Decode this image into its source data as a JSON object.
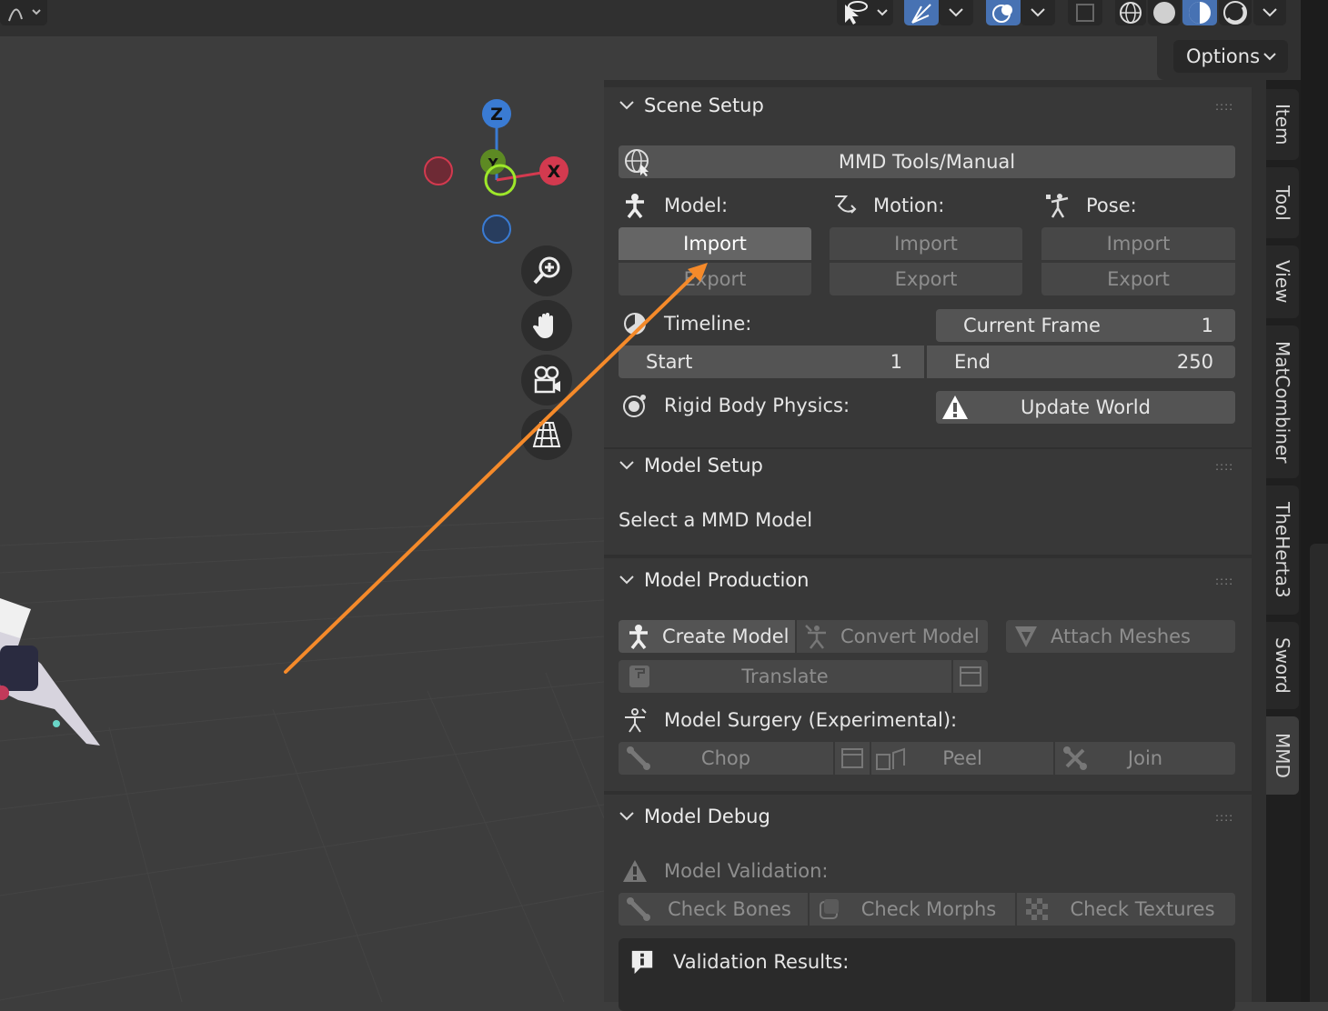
{
  "header": {
    "options_label": "Options"
  },
  "gizmo": {
    "z_label": "Z",
    "x_label": "X",
    "y_label": "Y"
  },
  "scene_setup": {
    "title": "Scene Setup",
    "manual_button": "MMD Tools/Manual",
    "model_label": "Model:",
    "motion_label": "Motion:",
    "pose_label": "Pose:",
    "model_import": "Import",
    "model_export": "Export",
    "motion_import": "Import",
    "motion_export": "Export",
    "pose_import": "Import",
    "pose_export": "Export",
    "timeline_label": "Timeline:",
    "current_frame_label": "Current Frame",
    "current_frame_value": "1",
    "start_label": "Start",
    "start_value": "1",
    "end_label": "End",
    "end_value": "250",
    "rigid_body_label": "Rigid Body Physics:",
    "update_world_button": "Update World"
  },
  "model_setup": {
    "title": "Model Setup",
    "message": "Select a MMD Model"
  },
  "model_production": {
    "title": "Model Production",
    "create_model": "Create Model",
    "convert_model": "Convert Model",
    "attach_meshes": "Attach Meshes",
    "translate": "Translate",
    "surgery_label": "Model Surgery (Experimental):",
    "chop": "Chop",
    "peel": "Peel",
    "join": "Join"
  },
  "model_debug": {
    "title": "Model Debug",
    "validation_label": "Model Validation:",
    "check_bones": "Check Bones",
    "check_morphs": "Check Morphs",
    "check_textures": "Check Textures",
    "validation_results": "Validation Results:"
  },
  "tabs": [
    "Item",
    "Tool",
    "View",
    "MatCombiner",
    "TheHerta3",
    "Sword",
    "MMD"
  ],
  "colors": {
    "accent_blue": "#4772b3",
    "annotation_arrow": "#f58a2a",
    "axis_x": "#d33a4f",
    "axis_y": "#7fb522",
    "axis_z": "#3a7bd3"
  }
}
